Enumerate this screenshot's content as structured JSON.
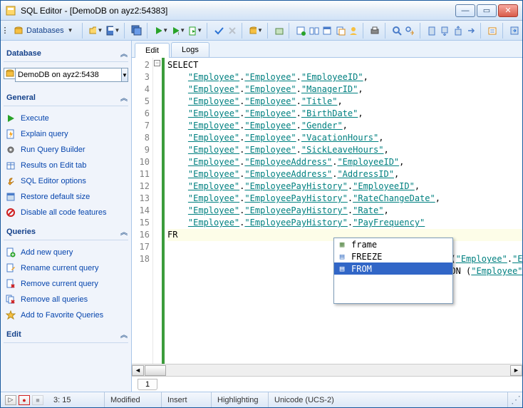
{
  "window": {
    "title": "SQL Editor - [DemoDB on ayz2:54383]"
  },
  "toolbar": {
    "databases_label": "Databases"
  },
  "sidebar": {
    "db_section": "Database",
    "db_value": "DemoDB on ayz2:5438",
    "general_section": "General",
    "general_items": [
      {
        "label": "Execute",
        "icon": "play-green"
      },
      {
        "label": "Explain query",
        "icon": "doc-lightning"
      },
      {
        "label": "Run Query Builder",
        "icon": "gear"
      },
      {
        "label": "Results on Edit tab",
        "icon": "table"
      },
      {
        "label": "SQL Editor options",
        "icon": "wrench"
      },
      {
        "label": "Restore default size",
        "icon": "window"
      },
      {
        "label": "Disable all code features",
        "icon": "no"
      }
    ],
    "queries_section": "Queries",
    "queries_items": [
      {
        "label": "Add new query",
        "icon": "doc-plus"
      },
      {
        "label": "Rename current query",
        "icon": "doc-rename"
      },
      {
        "label": "Remove current query",
        "icon": "doc-x"
      },
      {
        "label": "Remove all queries",
        "icon": "docs-x"
      },
      {
        "label": "Add to Favorite Queries",
        "icon": "star"
      }
    ],
    "edit_section": "Edit"
  },
  "tabs": {
    "edit": "Edit",
    "logs": "Logs"
  },
  "code": {
    "lines": [
      "SELECT",
      "    \"Employee\".\"Employee\".\"EmployeeID\",",
      "    \"Employee\".\"Employee\".\"ManagerID\",",
      "    \"Employee\".\"Employee\".\"Title\",",
      "    \"Employee\".\"Employee\".\"BirthDate\",",
      "    \"Employee\".\"Employee\".\"Gender\",",
      "    \"Employee\".\"Employee\".\"VacationHours\",",
      "    \"Employee\".\"Employee\".\"SickLeaveHours\",",
      "    \"Employee\".\"EmployeeAddress\".\"EmployeeID\",",
      "    \"Employee\".\"EmployeeAddress\".\"AddressID\",",
      "    \"Employee\".\"EmployeePayHistory\".\"EmployeeID\",",
      "    \"Employee\".\"EmployeePayHistory\".\"RateChangeDate\",",
      "    \"Employee\".\"EmployeePayHistory\".\"Rate\",",
      "    \"Employee\".\"EmployeePayHistory\".\"PayFrequency\"",
      "FR",
      "                                      ",
      "                                  \"EmployeeAddress\" ON (\"Employee\".\"E",
      "                                  \"EmployeePayHistory\" ON (\"Employee\""
    ],
    "gutter": [
      "",
      "2",
      "3",
      "4",
      "5",
      "6",
      "7",
      "8",
      "9",
      "10",
      "11",
      "12",
      "13",
      "14",
      "15",
      "16",
      "17",
      "18"
    ]
  },
  "autocomplete": {
    "items": [
      "frame",
      "FREEZE",
      "FROM"
    ],
    "selected": 2
  },
  "page_tab": "1",
  "status": {
    "pos": "3:  15",
    "modified": "Modified",
    "mode": "Insert",
    "highlight": "Highlighting",
    "encoding": "Unicode (UCS-2)"
  }
}
